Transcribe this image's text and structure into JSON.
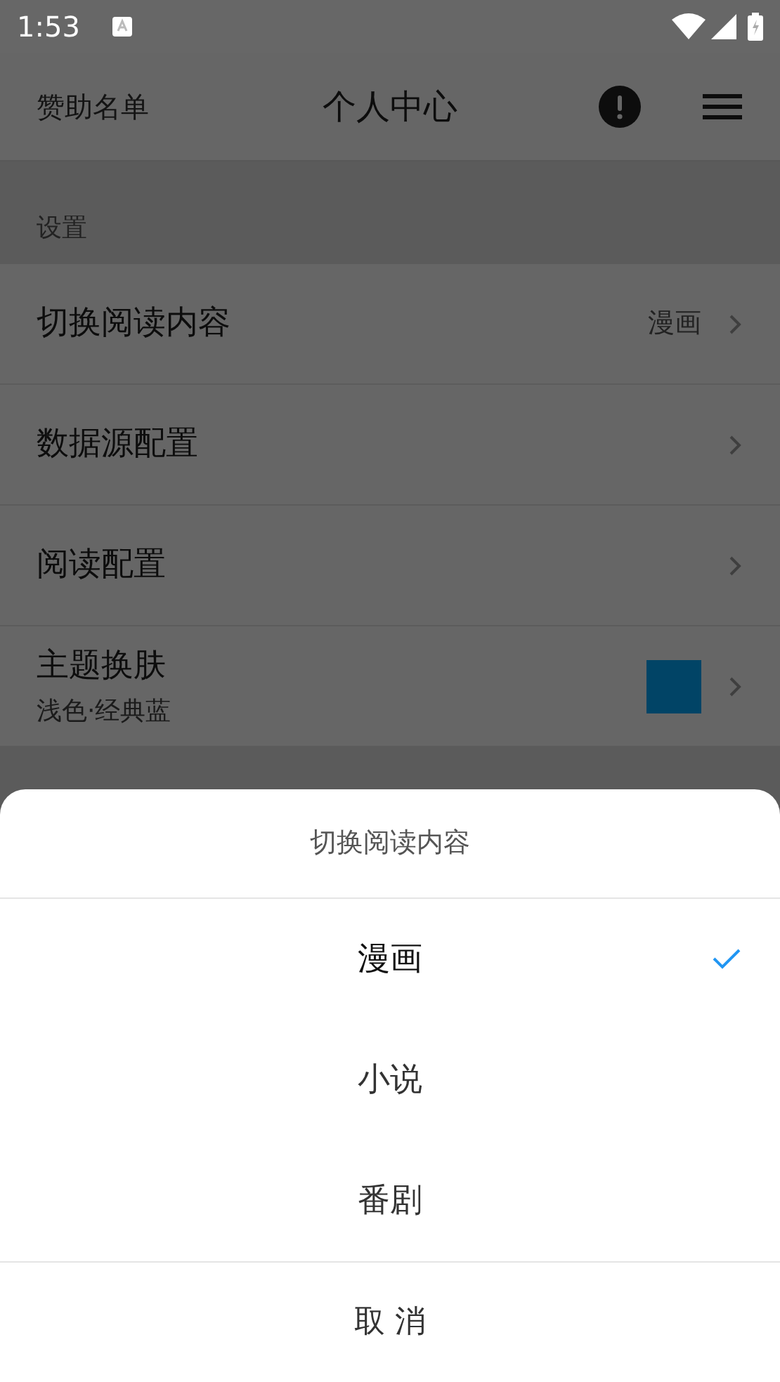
{
  "status_bar": {
    "time": "1:53"
  },
  "app_bar": {
    "left_link": "赞助名单",
    "title": "个人中心"
  },
  "sections": [
    {
      "title": "设置",
      "items": [
        {
          "label": "切换阅读内容",
          "value": "漫画"
        },
        {
          "label": "数据源配置"
        },
        {
          "label": "阅读配置"
        },
        {
          "label": "主题换肤",
          "subtitle": "浅色·经典蓝",
          "color": "#014466"
        }
      ]
    }
  ],
  "sheet": {
    "title": "切换阅读内容",
    "options": [
      {
        "label": "漫画",
        "selected": true
      },
      {
        "label": "小说",
        "selected": false
      },
      {
        "label": "番剧",
        "selected": false
      }
    ],
    "cancel": "取 消"
  }
}
